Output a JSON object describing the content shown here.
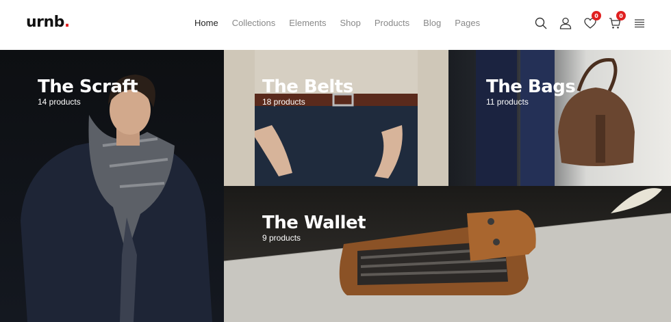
{
  "brand": {
    "name": "urnb",
    "dot": ".",
    "accent": "#e02020"
  },
  "nav": {
    "items": [
      {
        "label": "Home"
      },
      {
        "label": "Collections"
      },
      {
        "label": "Elements"
      },
      {
        "label": "Shop"
      },
      {
        "label": "Products"
      },
      {
        "label": "Blog"
      },
      {
        "label": "Pages"
      }
    ],
    "active": "Home"
  },
  "header_icons": {
    "search": "search-icon",
    "account": "user-icon",
    "wishlist": {
      "icon": "heart-icon",
      "count": "0"
    },
    "cart": {
      "icon": "cart-icon",
      "count": "0"
    },
    "menu": "hamburger-menu-icon"
  },
  "collections": [
    {
      "title": "The Scraft",
      "count": "14 products"
    },
    {
      "title": "The Belts",
      "count": "18 products"
    },
    {
      "title": "The Bags",
      "count": "11 products"
    },
    {
      "title": "The Wallet",
      "count": "9 products"
    }
  ]
}
